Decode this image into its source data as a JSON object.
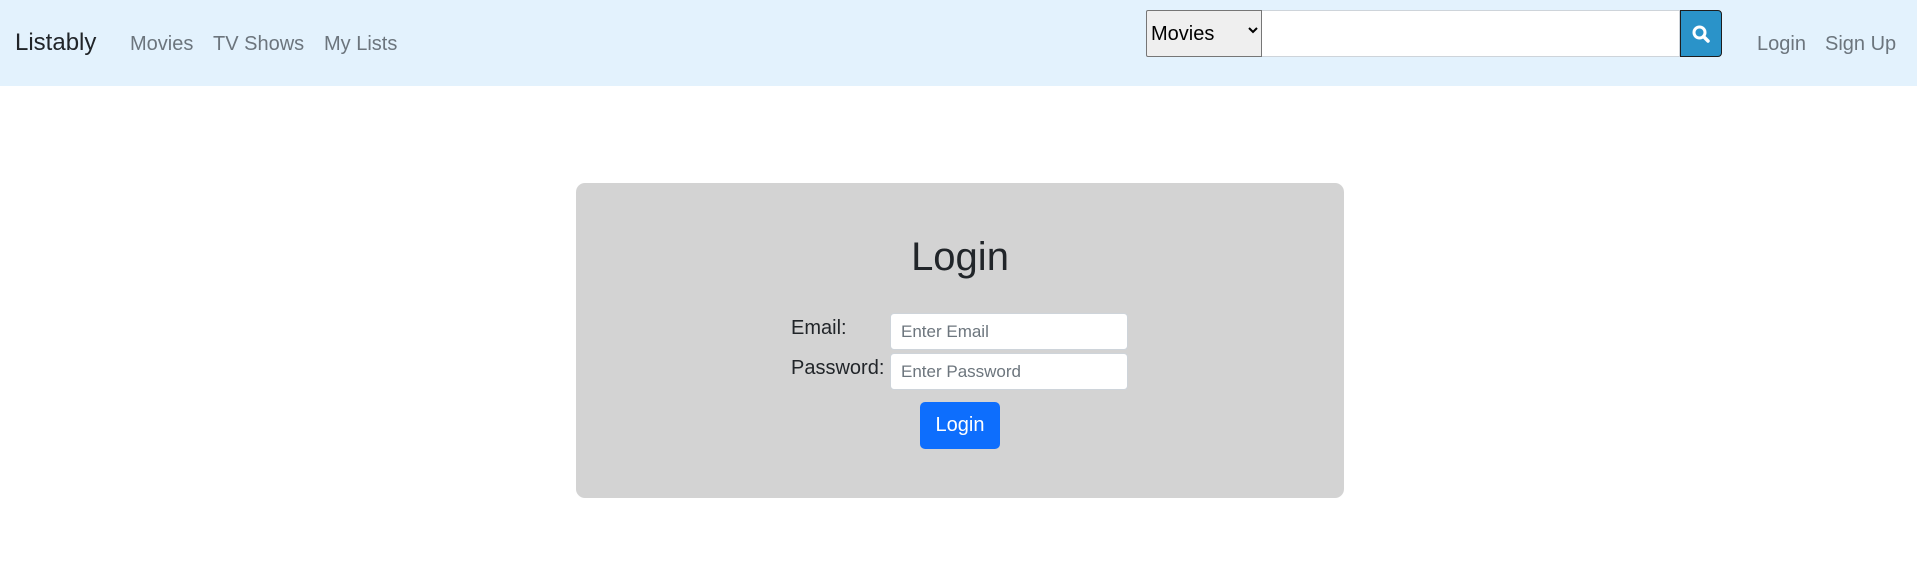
{
  "navbar": {
    "brand": "Listably",
    "links": [
      "Movies",
      "TV Shows",
      "My Lists"
    ],
    "search": {
      "category_selected": "Movies",
      "query": "",
      "placeholder": ""
    },
    "auth_links": [
      "Login",
      "Sign Up"
    ],
    "background_color": "#e3f2fd",
    "search_button_color": "#2a93c9",
    "icons": {
      "search": "search-icon",
      "select_arrow": "chevron-down-icon"
    }
  },
  "login_form": {
    "title": "Login",
    "email_label": "Email:",
    "email_placeholder": "Enter Email",
    "password_label": "Password:",
    "password_placeholder": "Enter Password",
    "submit_label": "Login",
    "card_color": "#d3d3d3",
    "button_color": "#0d6efd"
  }
}
